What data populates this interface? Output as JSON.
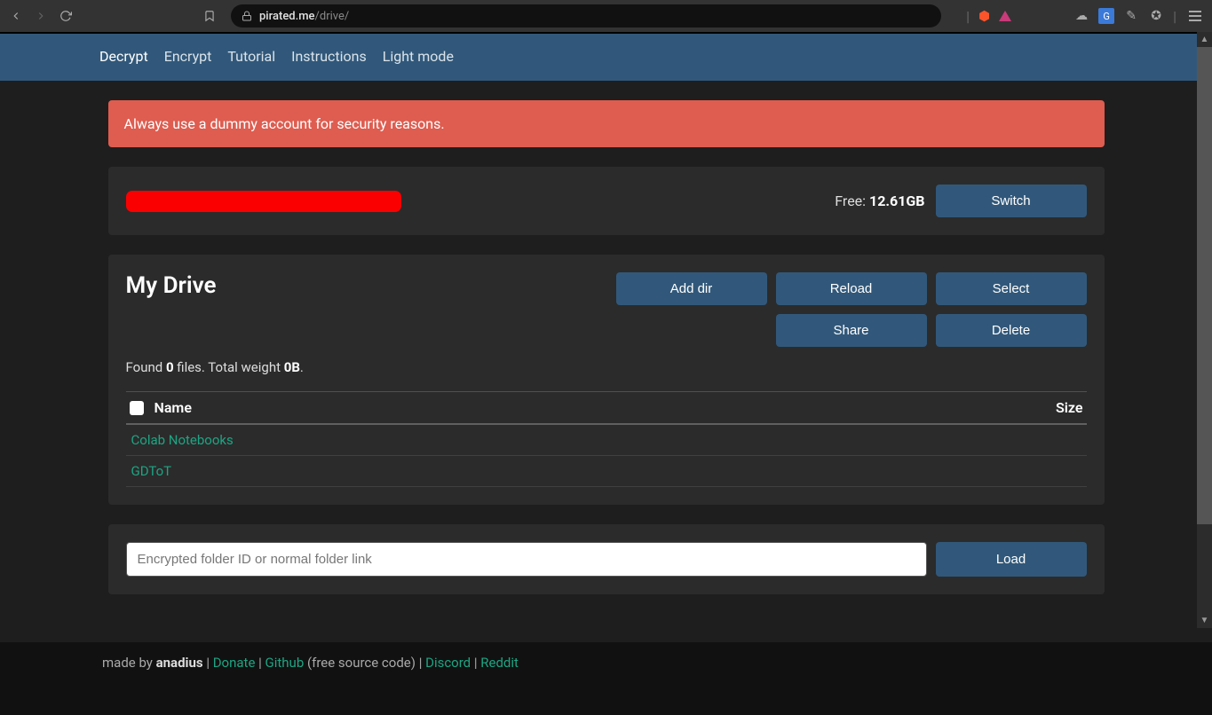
{
  "browser": {
    "url_domain": "pirated.me",
    "url_path": "/drive/"
  },
  "nav": {
    "items": [
      "Decrypt",
      "Encrypt",
      "Tutorial",
      "Instructions",
      "Light mode"
    ],
    "active_index": 0
  },
  "alert": {
    "message": "Always use a dummy account for security reasons."
  },
  "account": {
    "free_label": "Free: ",
    "free_value": "12.61GB",
    "switch_label": "Switch"
  },
  "drive": {
    "title": "My Drive",
    "buttons": {
      "add_dir": "Add dir",
      "reload": "Reload",
      "select": "Select",
      "share": "Share",
      "delete": "Delete"
    },
    "found_prefix": "Found ",
    "found_count": "0",
    "found_mid": " files. Total weight ",
    "found_weight": "0B",
    "found_suffix": ".",
    "columns": {
      "name": "Name",
      "size": "Size"
    },
    "rows": [
      {
        "name": "Colab Notebooks"
      },
      {
        "name": "GDToT"
      }
    ]
  },
  "loader": {
    "placeholder": "Encrypted folder ID or normal folder link",
    "load_label": "Load"
  },
  "footer": {
    "made_by": "made by ",
    "author": "anadius",
    "sep": " | ",
    "donate": "Donate",
    "github": "Github",
    "github_note": " (free source code)",
    "discord": "Discord",
    "reddit": "Reddit"
  }
}
